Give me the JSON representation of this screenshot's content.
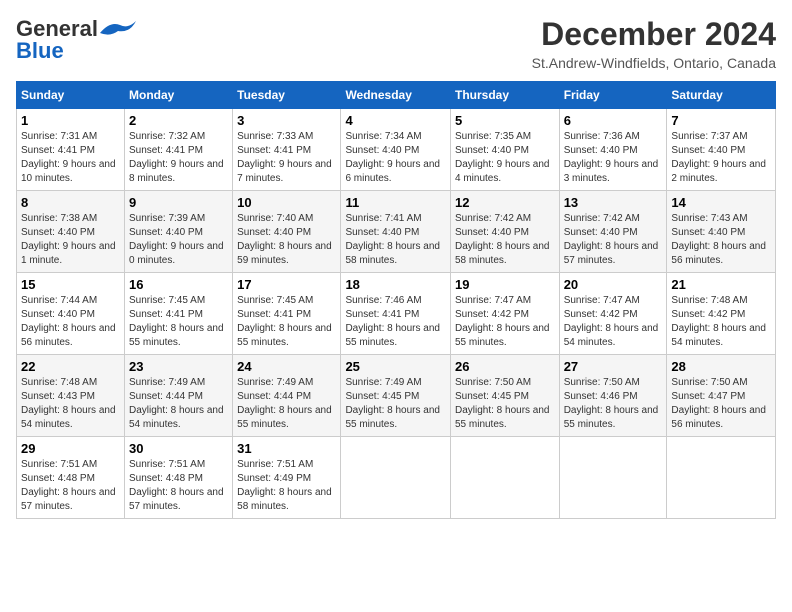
{
  "logo": {
    "line1": "General",
    "line2": "Blue"
  },
  "title": "December 2024",
  "subtitle": "St.Andrew-Windfields, Ontario, Canada",
  "days_of_week": [
    "Sunday",
    "Monday",
    "Tuesday",
    "Wednesday",
    "Thursday",
    "Friday",
    "Saturday"
  ],
  "weeks": [
    [
      {
        "day": "1",
        "info": "Sunrise: 7:31 AM\nSunset: 4:41 PM\nDaylight: 9 hours and 10 minutes."
      },
      {
        "day": "2",
        "info": "Sunrise: 7:32 AM\nSunset: 4:41 PM\nDaylight: 9 hours and 8 minutes."
      },
      {
        "day": "3",
        "info": "Sunrise: 7:33 AM\nSunset: 4:41 PM\nDaylight: 9 hours and 7 minutes."
      },
      {
        "day": "4",
        "info": "Sunrise: 7:34 AM\nSunset: 4:40 PM\nDaylight: 9 hours and 6 minutes."
      },
      {
        "day": "5",
        "info": "Sunrise: 7:35 AM\nSunset: 4:40 PM\nDaylight: 9 hours and 4 minutes."
      },
      {
        "day": "6",
        "info": "Sunrise: 7:36 AM\nSunset: 4:40 PM\nDaylight: 9 hours and 3 minutes."
      },
      {
        "day": "7",
        "info": "Sunrise: 7:37 AM\nSunset: 4:40 PM\nDaylight: 9 hours and 2 minutes."
      }
    ],
    [
      {
        "day": "8",
        "info": "Sunrise: 7:38 AM\nSunset: 4:40 PM\nDaylight: 9 hours and 1 minute."
      },
      {
        "day": "9",
        "info": "Sunrise: 7:39 AM\nSunset: 4:40 PM\nDaylight: 9 hours and 0 minutes."
      },
      {
        "day": "10",
        "info": "Sunrise: 7:40 AM\nSunset: 4:40 PM\nDaylight: 8 hours and 59 minutes."
      },
      {
        "day": "11",
        "info": "Sunrise: 7:41 AM\nSunset: 4:40 PM\nDaylight: 8 hours and 58 minutes."
      },
      {
        "day": "12",
        "info": "Sunrise: 7:42 AM\nSunset: 4:40 PM\nDaylight: 8 hours and 58 minutes."
      },
      {
        "day": "13",
        "info": "Sunrise: 7:42 AM\nSunset: 4:40 PM\nDaylight: 8 hours and 57 minutes."
      },
      {
        "day": "14",
        "info": "Sunrise: 7:43 AM\nSunset: 4:40 PM\nDaylight: 8 hours and 56 minutes."
      }
    ],
    [
      {
        "day": "15",
        "info": "Sunrise: 7:44 AM\nSunset: 4:40 PM\nDaylight: 8 hours and 56 minutes."
      },
      {
        "day": "16",
        "info": "Sunrise: 7:45 AM\nSunset: 4:41 PM\nDaylight: 8 hours and 55 minutes."
      },
      {
        "day": "17",
        "info": "Sunrise: 7:45 AM\nSunset: 4:41 PM\nDaylight: 8 hours and 55 minutes."
      },
      {
        "day": "18",
        "info": "Sunrise: 7:46 AM\nSunset: 4:41 PM\nDaylight: 8 hours and 55 minutes."
      },
      {
        "day": "19",
        "info": "Sunrise: 7:47 AM\nSunset: 4:42 PM\nDaylight: 8 hours and 55 minutes."
      },
      {
        "day": "20",
        "info": "Sunrise: 7:47 AM\nSunset: 4:42 PM\nDaylight: 8 hours and 54 minutes."
      },
      {
        "day": "21",
        "info": "Sunrise: 7:48 AM\nSunset: 4:42 PM\nDaylight: 8 hours and 54 minutes."
      }
    ],
    [
      {
        "day": "22",
        "info": "Sunrise: 7:48 AM\nSunset: 4:43 PM\nDaylight: 8 hours and 54 minutes."
      },
      {
        "day": "23",
        "info": "Sunrise: 7:49 AM\nSunset: 4:44 PM\nDaylight: 8 hours and 54 minutes."
      },
      {
        "day": "24",
        "info": "Sunrise: 7:49 AM\nSunset: 4:44 PM\nDaylight: 8 hours and 55 minutes."
      },
      {
        "day": "25",
        "info": "Sunrise: 7:49 AM\nSunset: 4:45 PM\nDaylight: 8 hours and 55 minutes."
      },
      {
        "day": "26",
        "info": "Sunrise: 7:50 AM\nSunset: 4:45 PM\nDaylight: 8 hours and 55 minutes."
      },
      {
        "day": "27",
        "info": "Sunrise: 7:50 AM\nSunset: 4:46 PM\nDaylight: 8 hours and 55 minutes."
      },
      {
        "day": "28",
        "info": "Sunrise: 7:50 AM\nSunset: 4:47 PM\nDaylight: 8 hours and 56 minutes."
      }
    ],
    [
      {
        "day": "29",
        "info": "Sunrise: 7:51 AM\nSunset: 4:48 PM\nDaylight: 8 hours and 57 minutes."
      },
      {
        "day": "30",
        "info": "Sunrise: 7:51 AM\nSunset: 4:48 PM\nDaylight: 8 hours and 57 minutes."
      },
      {
        "day": "31",
        "info": "Sunrise: 7:51 AM\nSunset: 4:49 PM\nDaylight: 8 hours and 58 minutes."
      },
      null,
      null,
      null,
      null
    ]
  ]
}
